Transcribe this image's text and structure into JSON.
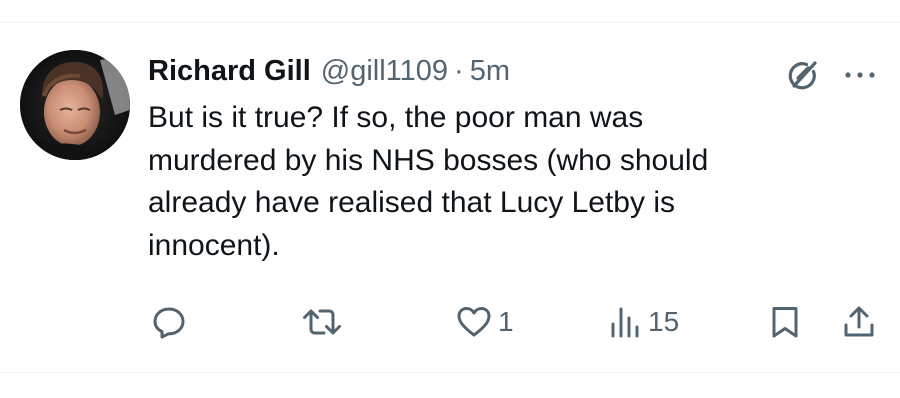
{
  "tweet": {
    "display_name": "Richard Gill",
    "handle": "@gill1109",
    "separator": "·",
    "time": "5m",
    "text": "But is it true? If so, the poor man was\nmurdered by his NHS bosses (who should\nalready have realised that Lucy Letby is\ninnocent)."
  },
  "actions": {
    "reply": {
      "icon": "reply-icon",
      "count": ""
    },
    "retweet": {
      "icon": "retweet-icon",
      "count": ""
    },
    "like": {
      "icon": "heart-icon",
      "count": "1"
    },
    "views": {
      "icon": "views-icon",
      "count": "15"
    },
    "bookmark": {
      "icon": "bookmark-icon"
    },
    "share": {
      "icon": "share-icon"
    }
  },
  "header_icons": {
    "grok": "grok-icon",
    "more": "more-icon"
  },
  "colors": {
    "text": "#0f1419",
    "secondary": "#536471",
    "divider": "#eff3f4"
  }
}
